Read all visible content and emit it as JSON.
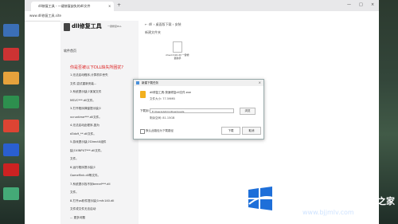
{
  "browser": {
    "tab_title": "dll修复工具 - 一键修复缺失的dll文件",
    "tab_close": "×",
    "new_tab": "+",
    "url": "www.dll修复工具.site",
    "window_controls": [
      "—",
      "□",
      "×"
    ]
  },
  "sidebar": {
    "logo_text": "dll修复工具",
    "logo_sub": "一键修复DLL",
    "home_label": "软件首页",
    "title": "你是否被以下DLL缺失所困扰?",
    "items": [
      "1.无法启动程序,计算机中丢失",
      "文件,尝试重新安装...",
      "2.系统提示缺少某某文件",
      "MSVC***.dll文件。",
      "3.打开程序弹窗提示缺少",
      "vcruntime***.dll文件。",
      "4.无法启动此程序,因为",
      "d3dx9_**.dll文件。",
      "5.游戏提示缺少DirectX组件",
      "缺少XINPUT***.dll文件。",
      "文件。",
      "6.运行程序提示缺少",
      "Gameflink.dll等文件。",
      "7.系统提示找不到kernel***.dll",
      "文件。",
      "8.打开ps软件提示缺少mfc140.dll",
      "文件或文件无法启动",
      "... 更多问题"
    ]
  },
  "main": {
    "breadcrumb": "←  dll   ›   桌面版下载   ›   安装",
    "toolbar": "新建文件夹",
    "file_name": "msvcr110.dll 一键修复助手"
  },
  "dialog": {
    "title": "新建下载任务",
    "close": "×",
    "file_name": "dll修复工具-快速修复dll文件.exe",
    "file_size": "文件大小: 77.59MB",
    "save_label": "下载到:",
    "save_path": "E:\\Users\\Admin\\Downloads",
    "browse_label": "浏览",
    "free_space": "剩余空间: 81.15GB",
    "checkbox_label": "默认此路径为下载路径",
    "download_label": "下载",
    "cancel_label": "取消"
  },
  "watermark": {
    "brand": "Windows",
    "sub": "系统之家",
    "url": "www.bjjmlv.com"
  },
  "colors": {
    "accent": "#d22222",
    "windows_blue": "#1e6fd9",
    "file_icon": "#f2b01e"
  }
}
